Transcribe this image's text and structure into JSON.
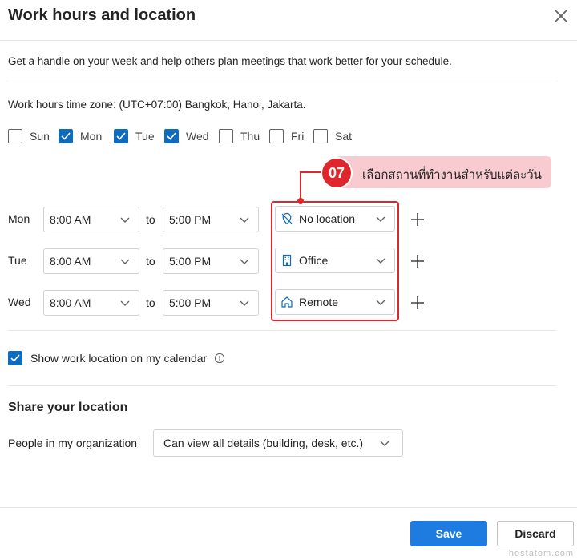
{
  "dialog": {
    "title": "Work hours and location",
    "description": "Get a handle on your week and help others plan meetings that work better for your schedule.",
    "timezone_text": "Work hours time zone: (UTC+07:00) Bangkok, Hanoi, Jakarta."
  },
  "days": [
    {
      "label": "Sun",
      "checked": false
    },
    {
      "label": "Mon",
      "checked": true
    },
    {
      "label": "Tue",
      "checked": true
    },
    {
      "label": "Wed",
      "checked": true
    },
    {
      "label": "Thu",
      "checked": false
    },
    {
      "label": "Fri",
      "checked": false
    },
    {
      "label": "Sat",
      "checked": false
    }
  ],
  "schedule": [
    {
      "day": "Mon",
      "start": "8:00 AM",
      "to": "to",
      "end": "5:00 PM",
      "location": "No location",
      "location_icon": "no-location-icon"
    },
    {
      "day": "Tue",
      "start": "8:00 AM",
      "to": "to",
      "end": "5:00 PM",
      "location": "Office",
      "location_icon": "building-icon"
    },
    {
      "day": "Wed",
      "start": "8:00 AM",
      "to": "to",
      "end": "5:00 PM",
      "location": "Remote",
      "location_icon": "home-icon"
    }
  ],
  "callout": {
    "number": "07",
    "text": "เลือกสถานที่ทำงานสำหรับแต่ละวัน",
    "color": "#e0262d",
    "pill_color": "#f8cbd0"
  },
  "show_location": {
    "label": "Show work location on my calendar",
    "checked": true
  },
  "share": {
    "heading": "Share your location",
    "people_label": "People in my organization",
    "people_value": "Can view all details (building, desk, etc.)"
  },
  "footer": {
    "save_label": "Save",
    "discard_label": "Discard",
    "watermark": "hostatom.com"
  },
  "colors": {
    "accent": "#0f6cbd",
    "save_button": "#1e7ce0"
  }
}
